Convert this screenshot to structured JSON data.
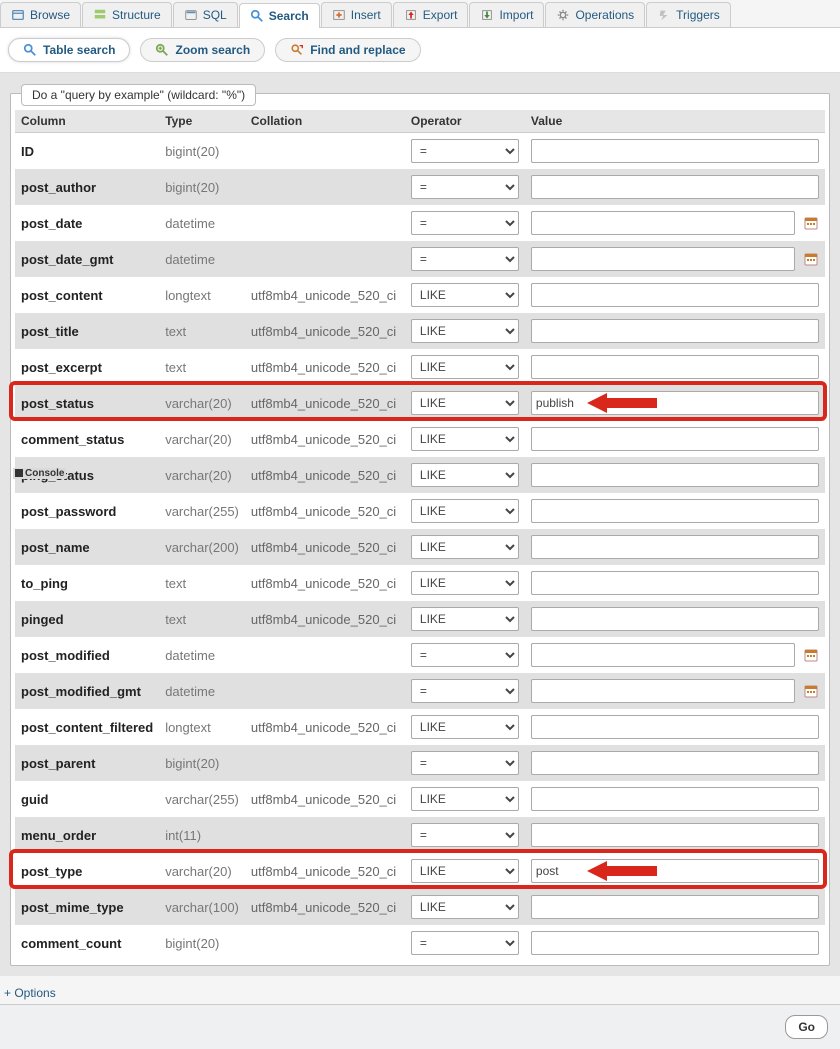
{
  "tabs": [
    {
      "label": "Browse",
      "icon": "browse"
    },
    {
      "label": "Structure",
      "icon": "structure"
    },
    {
      "label": "SQL",
      "icon": "sql"
    },
    {
      "label": "Search",
      "icon": "search",
      "active": true
    },
    {
      "label": "Insert",
      "icon": "insert"
    },
    {
      "label": "Export",
      "icon": "export"
    },
    {
      "label": "Import",
      "icon": "import"
    },
    {
      "label": "Operations",
      "icon": "operations"
    },
    {
      "label": "Triggers",
      "icon": "triggers"
    }
  ],
  "subtabs": {
    "table_search": "Table search",
    "zoom_search": "Zoom search",
    "find_replace": "Find and replace"
  },
  "legend": "Do a \"query by example\" (wildcard: \"%\")",
  "headers": {
    "column": "Column",
    "type": "Type",
    "collation": "Collation",
    "operator": "Operator",
    "value": "Value"
  },
  "rows": [
    {
      "name": "ID",
      "type": "bigint(20)",
      "coll": "",
      "op": "=",
      "val": "",
      "cal": false
    },
    {
      "name": "post_author",
      "type": "bigint(20)",
      "coll": "",
      "op": "=",
      "val": "",
      "cal": false
    },
    {
      "name": "post_date",
      "type": "datetime",
      "coll": "",
      "op": "=",
      "val": "",
      "cal": true
    },
    {
      "name": "post_date_gmt",
      "type": "datetime",
      "coll": "",
      "op": "=",
      "val": "",
      "cal": true
    },
    {
      "name": "post_content",
      "type": "longtext",
      "coll": "utf8mb4_unicode_520_ci",
      "op": "LIKE",
      "val": "",
      "cal": false
    },
    {
      "name": "post_title",
      "type": "text",
      "coll": "utf8mb4_unicode_520_ci",
      "op": "LIKE",
      "val": "",
      "cal": false
    },
    {
      "name": "post_excerpt",
      "type": "text",
      "coll": "utf8mb4_unicode_520_ci",
      "op": "LIKE",
      "val": "",
      "cal": false
    },
    {
      "name": "post_status",
      "type": "varchar(20)",
      "coll": "utf8mb4_unicode_520_ci",
      "op": "LIKE",
      "val": "publish",
      "cal": false,
      "highlight": true
    },
    {
      "name": "comment_status",
      "type": "varchar(20)",
      "coll": "utf8mb4_unicode_520_ci",
      "op": "LIKE",
      "val": "",
      "cal": false
    },
    {
      "name": "ping_status",
      "type": "varchar(20)",
      "coll": "utf8mb4_unicode_520_ci",
      "op": "LIKE",
      "val": "",
      "cal": false,
      "console": true
    },
    {
      "name": "post_password",
      "type": "varchar(255)",
      "coll": "utf8mb4_unicode_520_ci",
      "op": "LIKE",
      "val": "",
      "cal": false
    },
    {
      "name": "post_name",
      "type": "varchar(200)",
      "coll": "utf8mb4_unicode_520_ci",
      "op": "LIKE",
      "val": "",
      "cal": false
    },
    {
      "name": "to_ping",
      "type": "text",
      "coll": "utf8mb4_unicode_520_ci",
      "op": "LIKE",
      "val": "",
      "cal": false
    },
    {
      "name": "pinged",
      "type": "text",
      "coll": "utf8mb4_unicode_520_ci",
      "op": "LIKE",
      "val": "",
      "cal": false
    },
    {
      "name": "post_modified",
      "type": "datetime",
      "coll": "",
      "op": "=",
      "val": "",
      "cal": true
    },
    {
      "name": "post_modified_gmt",
      "type": "datetime",
      "coll": "",
      "op": "=",
      "val": "",
      "cal": true
    },
    {
      "name": "post_content_filtered",
      "type": "longtext",
      "coll": "utf8mb4_unicode_520_ci",
      "op": "LIKE",
      "val": "",
      "cal": false
    },
    {
      "name": "post_parent",
      "type": "bigint(20)",
      "coll": "",
      "op": "=",
      "val": "",
      "cal": false
    },
    {
      "name": "guid",
      "type": "varchar(255)",
      "coll": "utf8mb4_unicode_520_ci",
      "op": "LIKE",
      "val": "",
      "cal": false
    },
    {
      "name": "menu_order",
      "type": "int(11)",
      "coll": "",
      "op": "=",
      "val": "",
      "cal": false
    },
    {
      "name": "post_type",
      "type": "varchar(20)",
      "coll": "utf8mb4_unicode_520_ci",
      "op": "LIKE",
      "val": "post",
      "cal": false,
      "highlight": true
    },
    {
      "name": "post_mime_type",
      "type": "varchar(100)",
      "coll": "utf8mb4_unicode_520_ci",
      "op": "LIKE",
      "val": "",
      "cal": false
    },
    {
      "name": "comment_count",
      "type": "bigint(20)",
      "coll": "",
      "op": "=",
      "val": "",
      "cal": false
    }
  ],
  "console_label": "Console",
  "options_link": "+ Options",
  "go_button": "Go"
}
